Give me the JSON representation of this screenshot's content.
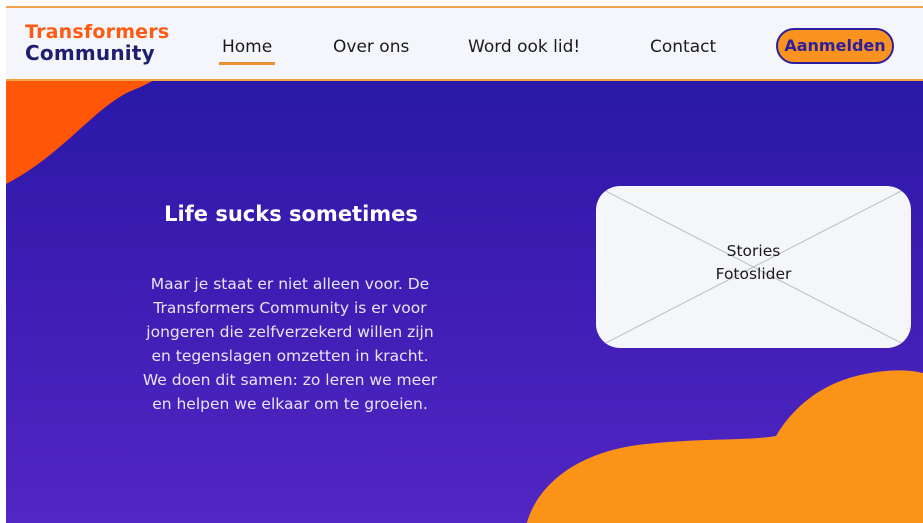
{
  "header": {
    "logo": {
      "line1": "Transformers",
      "line2": "Community"
    },
    "nav": [
      {
        "label": "Home",
        "active": true
      },
      {
        "label": "Over ons"
      },
      {
        "label": "Word ook lid!"
      },
      {
        "label": "Contact"
      }
    ],
    "cta_label": "Aanmelden"
  },
  "hero": {
    "title": "Life sucks sometimes",
    "body": "Maar je staat er niet alleen voor. De Transformers Community is er voor jongeren die zelfverzekerd willen zijn en tegenslagen omzetten in kracht. We doen dit samen: zo leren we meer en helpen we elkaar om te groeien."
  },
  "placeholder": {
    "line1": "Stories",
    "line2": "Fotoslider"
  },
  "colors": {
    "brand_orange": "#ff5a14",
    "accent_orange": "#f9921f",
    "navy": "#1e1f6e",
    "hero_gradient_top": "#2118a5",
    "hero_gradient_bottom": "#5226c4",
    "header_bg": "#f4f6fb"
  }
}
